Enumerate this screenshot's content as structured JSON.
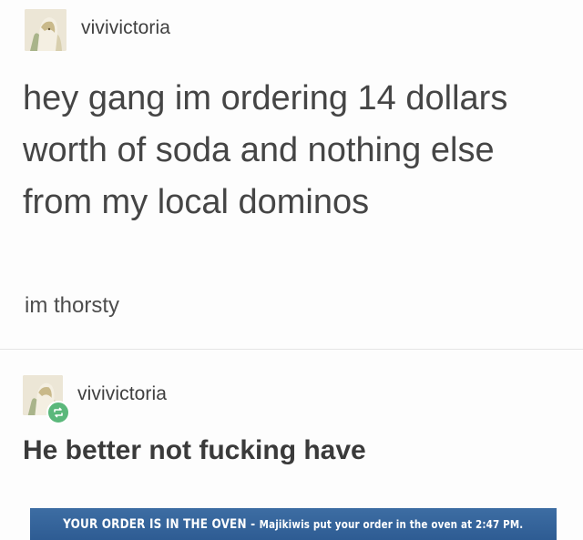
{
  "post": {
    "username": "vivivictoria",
    "body": "hey gang im ordering 14 dollars worth of soda and nothing else from my local dominos",
    "subtext": "im thorsty"
  },
  "reblog": {
    "username": "vivivictoria",
    "text": "He better not fucking have"
  },
  "banner": {
    "main": "YOUR ORDER IS IN THE OVEN",
    "separator": " - ",
    "detail": "Majikiwis put your order in the oven at 2:47 PM."
  },
  "icons": {
    "avatar": "avatar-icon",
    "reblog": "reblog-icon"
  },
  "colors": {
    "banner_bg": "#2e5c93",
    "reblog_badge": "#5bb87b"
  }
}
